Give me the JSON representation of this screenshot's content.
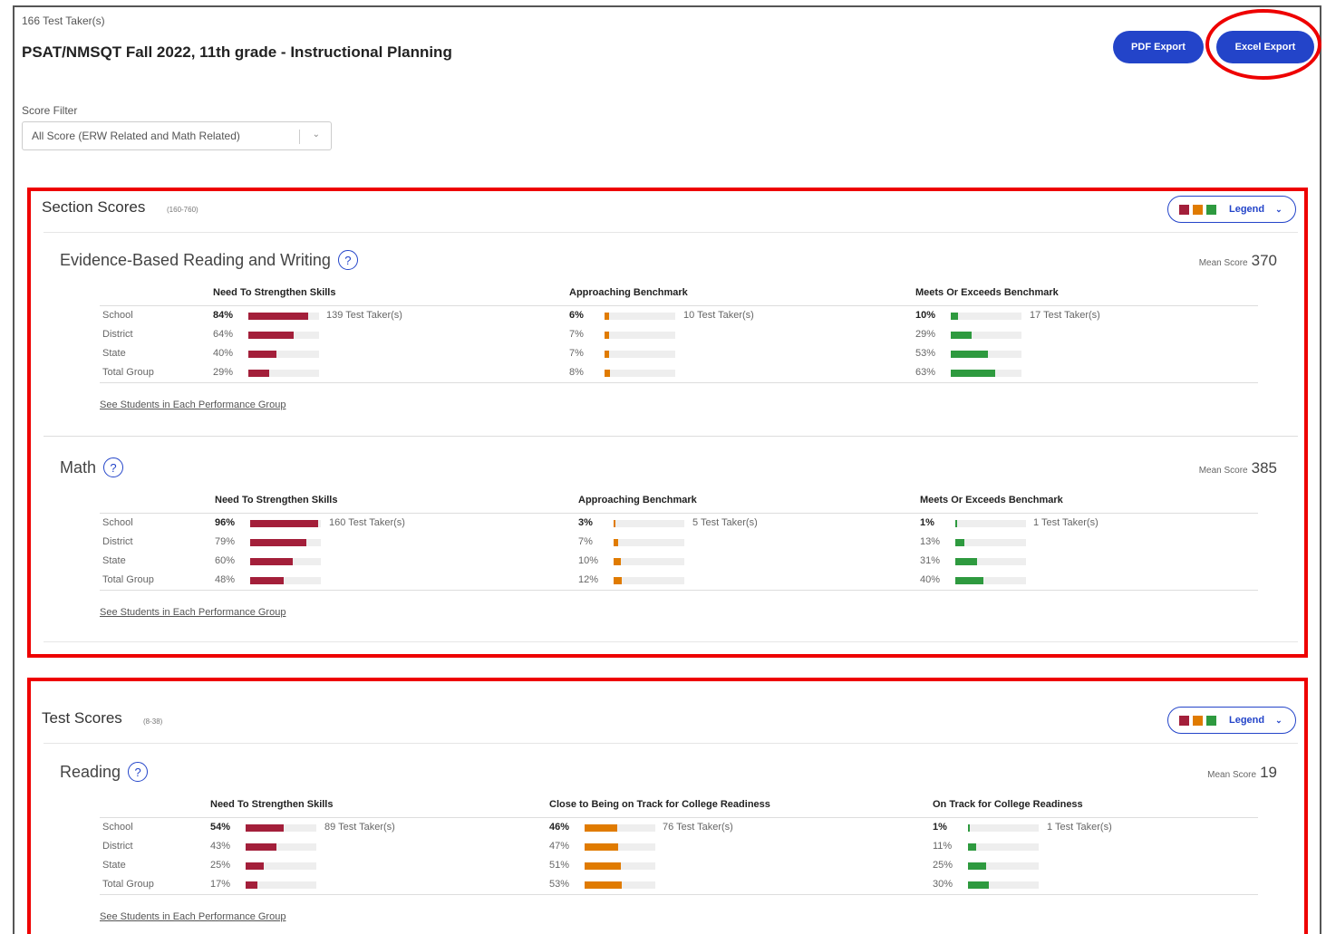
{
  "header": {
    "taker_count": "166 Test Taker(s)",
    "title": "PSAT/NMSQT Fall 2022, 11th grade - Instructional Planning",
    "pdf_export": "PDF Export",
    "excel_export": "Excel Export"
  },
  "filter": {
    "label": "Score Filter",
    "value": "All Score (ERW Related and Math Related)"
  },
  "colors": {
    "red": "#a31f3a",
    "orange": "#e07b00",
    "green": "#2e9a3f",
    "blue": "#2344c9"
  },
  "legend": {
    "label": "Legend"
  },
  "row_labels": [
    "School",
    "District",
    "State",
    "Total Group"
  ],
  "see_students": "See Students in Each Performance Group",
  "mean_label": "Mean Score",
  "section_scores": {
    "title": "Section Scores",
    "range": "(160-760)",
    "subjects": [
      {
        "name": "Evidence-Based Reading and Writing",
        "mean": "370",
        "groups": [
          {
            "head": "Need To Strengthen Skills",
            "color": "red",
            "pcts": [
              "84%",
              "64%",
              "40%",
              "29%"
            ],
            "values": [
              84,
              64,
              40,
              29
            ],
            "takers": "139 Test Taker(s)"
          },
          {
            "head": "Approaching Benchmark",
            "color": "orange",
            "pcts": [
              "6%",
              "7%",
              "7%",
              "8%"
            ],
            "values": [
              6,
              7,
              7,
              8
            ],
            "takers": "10 Test Taker(s)"
          },
          {
            "head": "Meets Or Exceeds Benchmark",
            "color": "green",
            "pcts": [
              "10%",
              "29%",
              "53%",
              "63%"
            ],
            "values": [
              10,
              29,
              53,
              63
            ],
            "takers": "17 Test Taker(s)"
          }
        ]
      },
      {
        "name": "Math",
        "mean": "385",
        "groups": [
          {
            "head": "Need To Strengthen Skills",
            "color": "red",
            "pcts": [
              "96%",
              "79%",
              "60%",
              "48%"
            ],
            "values": [
              96,
              79,
              60,
              48
            ],
            "takers": "160 Test Taker(s)"
          },
          {
            "head": "Approaching Benchmark",
            "color": "orange",
            "pcts": [
              "3%",
              "7%",
              "10%",
              "12%"
            ],
            "values": [
              3,
              7,
              10,
              12
            ],
            "takers": "5 Test Taker(s)"
          },
          {
            "head": "Meets Or Exceeds Benchmark",
            "color": "green",
            "pcts": [
              "1%",
              "13%",
              "31%",
              "40%"
            ],
            "values": [
              1,
              13,
              31,
              40
            ],
            "takers": "1 Test Taker(s)"
          }
        ]
      }
    ]
  },
  "test_scores": {
    "title": "Test Scores",
    "range": "(8-38)",
    "subjects": [
      {
        "name": "Reading",
        "mean": "19",
        "groups": [
          {
            "head": "Need To Strengthen Skills",
            "color": "red",
            "pcts": [
              "54%",
              "43%",
              "25%",
              "17%"
            ],
            "values": [
              54,
              43,
              25,
              17
            ],
            "takers": "89 Test Taker(s)"
          },
          {
            "head": "Close to Being on Track for College Readiness",
            "color": "orange",
            "pcts": [
              "46%",
              "47%",
              "51%",
              "53%"
            ],
            "values": [
              46,
              47,
              51,
              53
            ],
            "takers": "76 Test Taker(s)"
          },
          {
            "head": "On Track for College Readiness",
            "color": "green",
            "pcts": [
              "1%",
              "11%",
              "25%",
              "30%"
            ],
            "values": [
              1,
              11,
              25,
              30
            ],
            "takers": "1 Test Taker(s)"
          }
        ]
      }
    ]
  }
}
